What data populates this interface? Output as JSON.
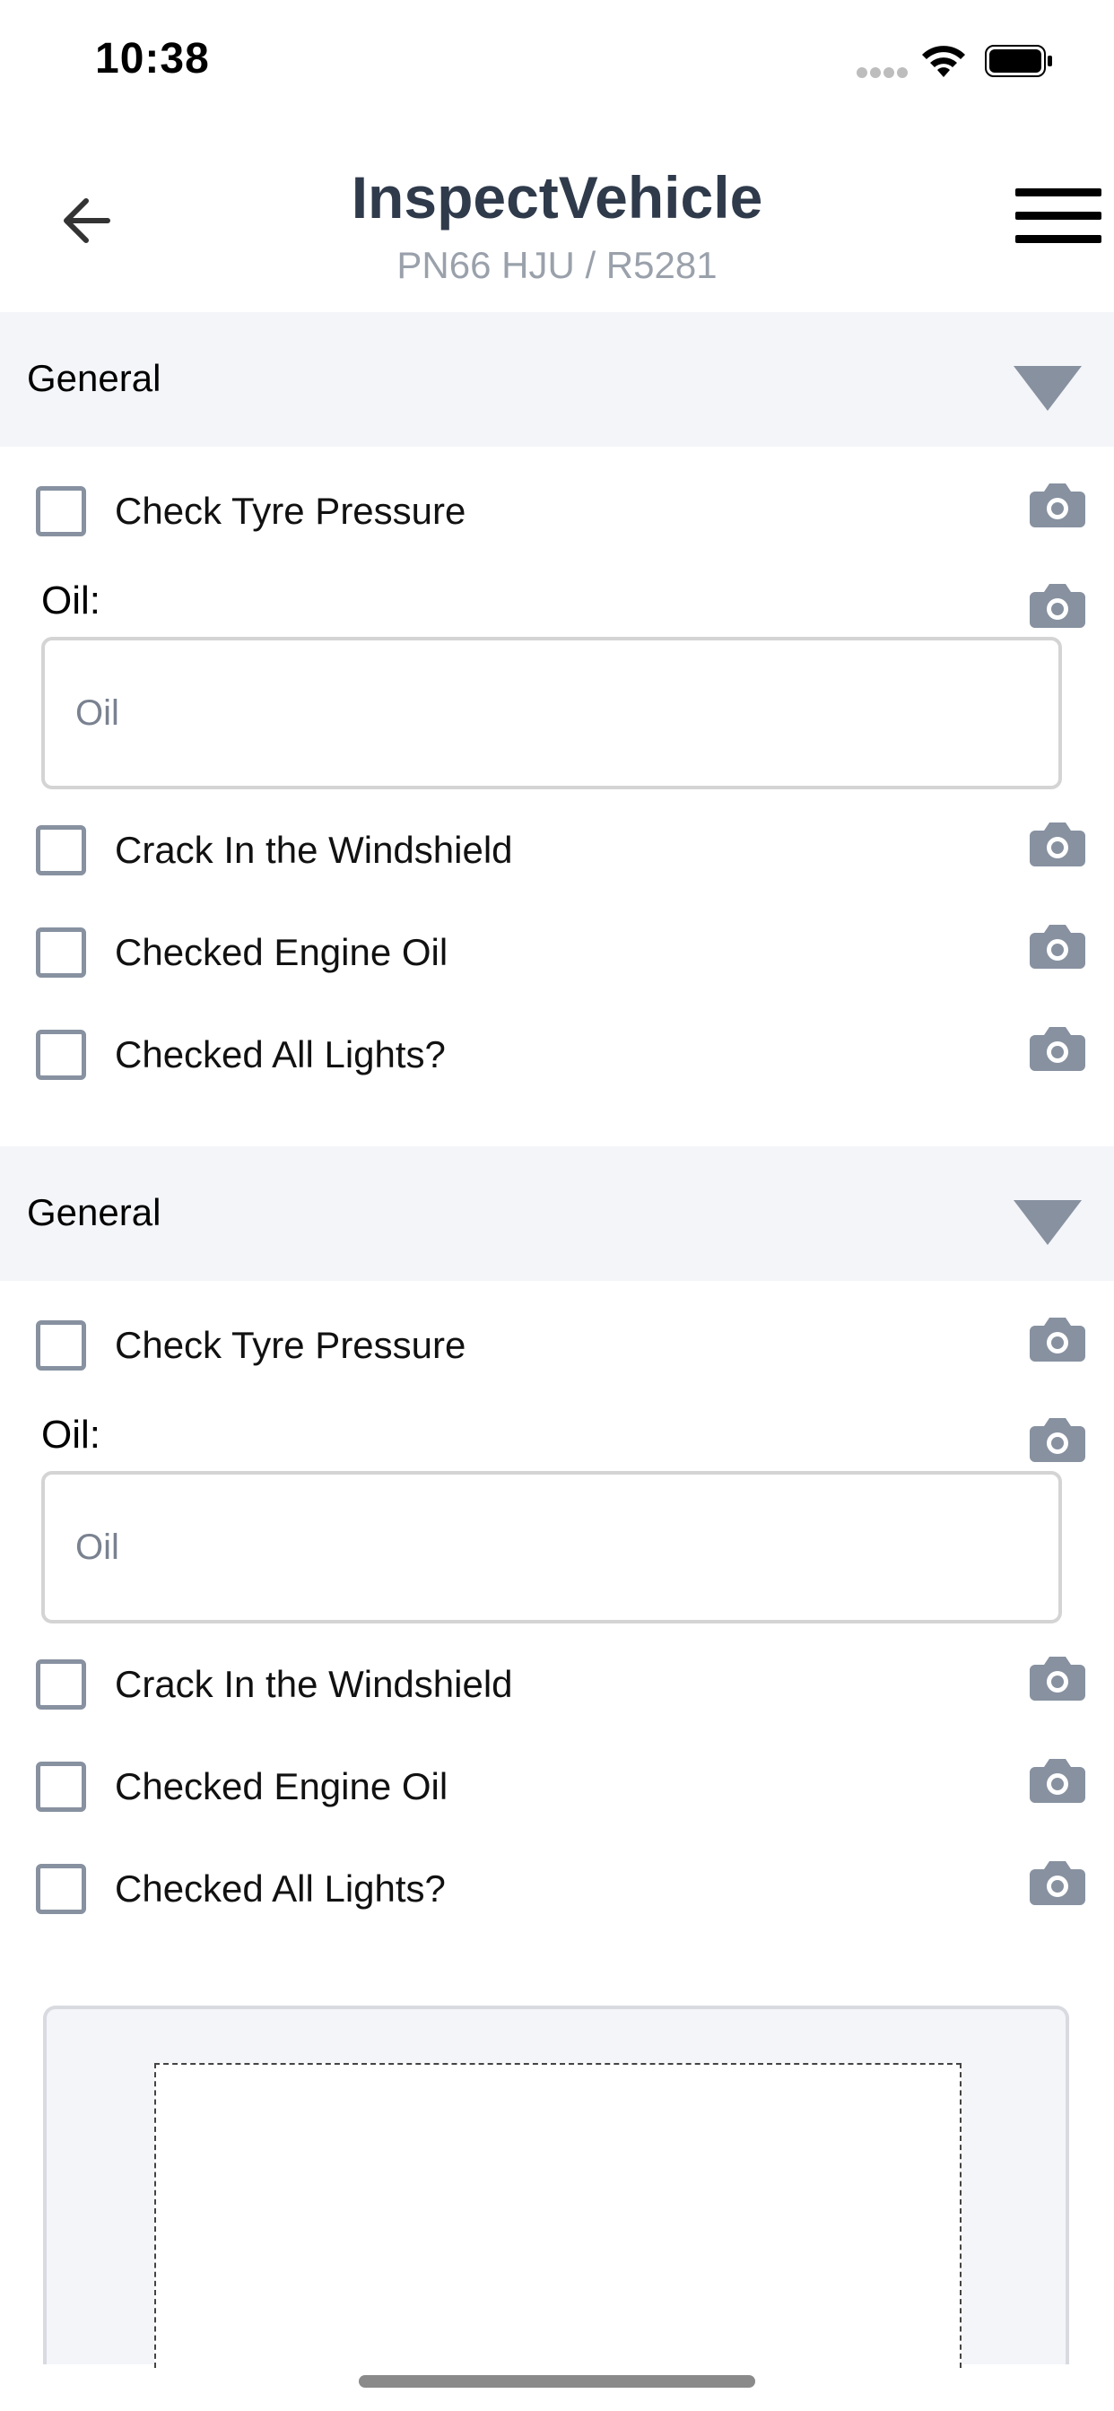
{
  "status_bar": {
    "time": "10:38",
    "wifi_icon": "wifi-icon",
    "battery_icon": "battery-icon"
  },
  "header": {
    "title": "InspectVehicle",
    "subtitle": "PN66 HJU / R5281",
    "back_icon": "arrow-left-icon",
    "menu_icon": "hamburger-menu-icon"
  },
  "sections": [
    {
      "title": "General",
      "items": [
        {
          "label": "Check Tyre Pressure"
        },
        {
          "oil_label": "Oil:",
          "oil_placeholder": "Oil"
        },
        {
          "label": "Crack In the Windshield"
        },
        {
          "label": "Checked Engine Oil"
        },
        {
          "label": "Checked All Lights?"
        }
      ]
    },
    {
      "title": "General",
      "items": [
        {
          "label": "Check Tyre Pressure"
        },
        {
          "oil_label": "Oil:",
          "oil_placeholder": "Oil"
        },
        {
          "label": "Crack In the Windshield"
        },
        {
          "label": "Checked Engine Oil"
        },
        {
          "label": "Checked All Lights?"
        }
      ]
    }
  ],
  "colors": {
    "accent_gray": "#8791a0",
    "section_bg": "#f4f5f9",
    "title": "#2f3a4b"
  }
}
